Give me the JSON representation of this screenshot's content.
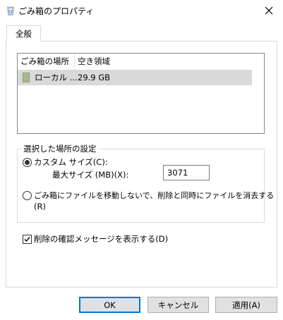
{
  "window": {
    "title": "ごみ箱のプロパティ",
    "close_icon": "close-icon"
  },
  "tabs": [
    {
      "label": "全般",
      "selected": true
    }
  ],
  "location_list": {
    "columns": [
      "ごみ箱の場所",
      "空き領域"
    ],
    "rows": [
      {
        "location": "ローカル ...",
        "free_space": "29.9 GB",
        "selected": true
      }
    ]
  },
  "settings_group": {
    "legend": "選択した場所の設定",
    "custom_size": {
      "label": "カスタム サイズ(C):",
      "checked": true,
      "max_size_label": "最大サイズ (MB)(X):",
      "max_size_value": "3071"
    },
    "no_recycle": {
      "label_line1": "ごみ箱にファイルを移動しないで、削除と同時にファイルを消去する",
      "label_line2": "(R)",
      "checked": false
    }
  },
  "confirm_delete": {
    "label": "削除の確認メッセージを表示する(D)",
    "checked": true
  },
  "buttons": {
    "ok": "OK",
    "cancel": "キャンセル",
    "apply": "適用(A)"
  },
  "colors": {
    "accent": "#0078d7",
    "selected_row": "#d9d9d9",
    "button_face": "#e1e1e1"
  }
}
